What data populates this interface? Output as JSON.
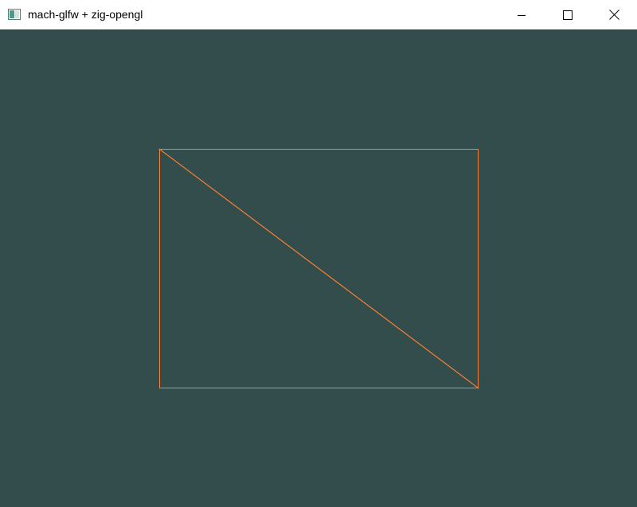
{
  "window": {
    "title": "mach-glfw + zig-opengl",
    "app_icon": "app-window-icon",
    "controls": {
      "minimize": "minimize-icon",
      "maximize": "maximize-icon",
      "close": "close-icon"
    }
  },
  "render": {
    "clear_color": "#334d4d",
    "line_color": "#ff8033",
    "mode": "wireframe",
    "primitives": "two triangles forming a rectangle with one diagonal"
  }
}
